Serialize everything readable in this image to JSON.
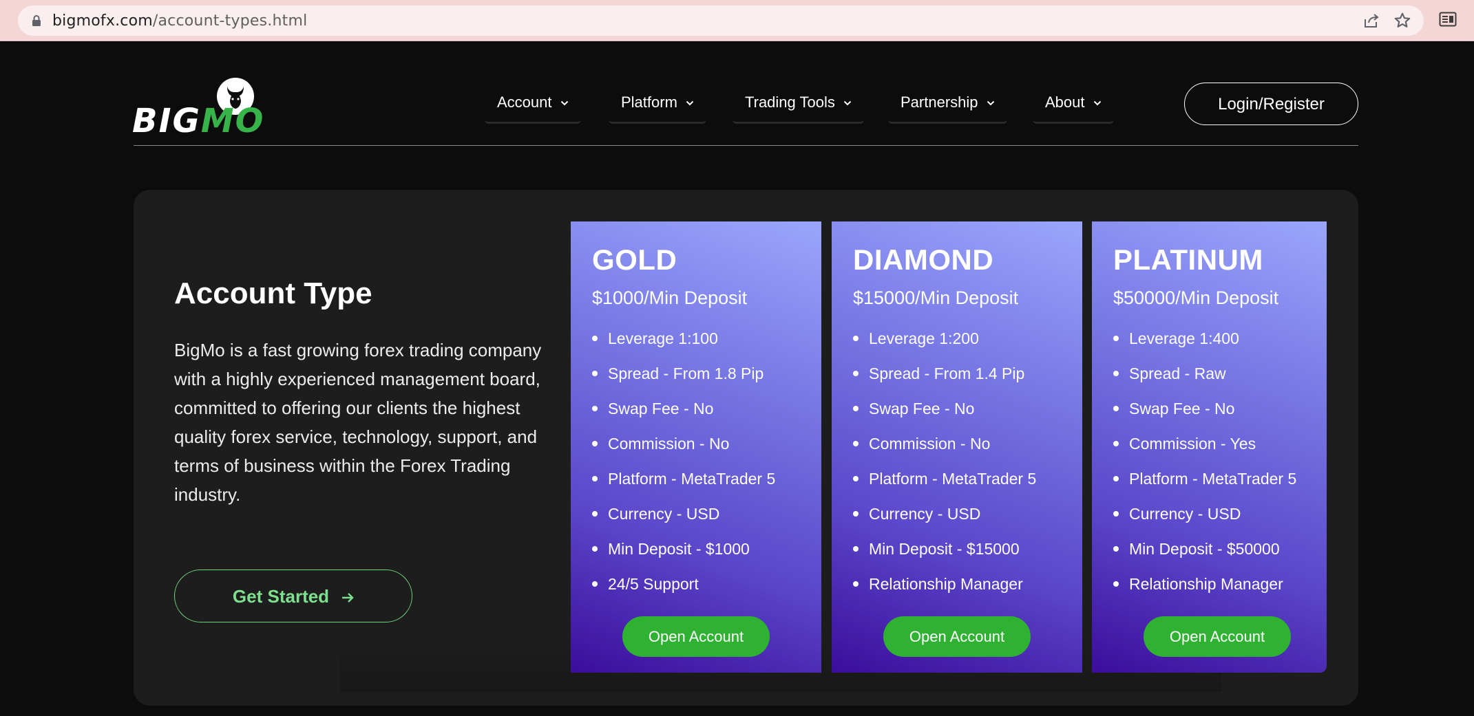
{
  "browser": {
    "url_domain": "bigmofx.com",
    "url_path": "/account-types.html"
  },
  "header": {
    "logo_big": "BIG",
    "logo_mo": "MO",
    "nav": [
      {
        "label": "Account"
      },
      {
        "label": "Platform"
      },
      {
        "label": "Trading Tools"
      },
      {
        "label": "Partnership"
      },
      {
        "label": "About"
      }
    ],
    "login_label": "Login/Register"
  },
  "intro": {
    "title": "Account Type",
    "description": "BigMo is a fast growing forex trading company with a highly experienced management board, committed to offering our clients the highest quality forex service, technology, support, and terms of business within the Forex Trading industry.",
    "cta_label": "Get Started"
  },
  "cards": [
    {
      "name": "GOLD",
      "deposit": "$1000/Min Deposit",
      "features": [
        "Leverage 1:100",
        "Spread - From 1.8 Pip",
        "Swap Fee - No",
        "Commission - No",
        "Platform - MetaTrader 5",
        "Currency - USD",
        "Min Deposit - $1000",
        "24/5 Support"
      ],
      "button": "Open Account"
    },
    {
      "name": "DIAMOND",
      "deposit": "$15000/Min Deposit",
      "features": [
        "Leverage 1:200",
        "Spread - From 1.4 Pip",
        "Swap Fee - No",
        "Commission - No",
        "Platform - MetaTrader 5",
        "Currency - USD",
        "Min Deposit - $15000",
        "Relationship Manager"
      ],
      "button": "Open Account"
    },
    {
      "name": "PLATINUM",
      "deposit": "$50000/Min Deposit",
      "features": [
        "Leverage 1:400",
        "Spread - Raw",
        "Swap Fee - No",
        "Commission - Yes",
        "Platform - MetaTrader 5",
        "Currency - USD",
        "Min Deposit - $50000",
        "Relationship Manager"
      ],
      "button": "Open Account"
    }
  ],
  "colors": {
    "background": "#0c0c0c",
    "panel": "#1d1d1d",
    "brand_green": "#37b34a",
    "button_green": "#2fb232",
    "card_gradient_top": "#9aa6fb",
    "card_gradient_bottom": "#3b0d9a"
  },
  "icons": [
    "lock-icon",
    "share-icon",
    "star-icon",
    "reader-mode-icon",
    "bull-icon",
    "chevron-down-icon",
    "arrow-right-icon"
  ]
}
